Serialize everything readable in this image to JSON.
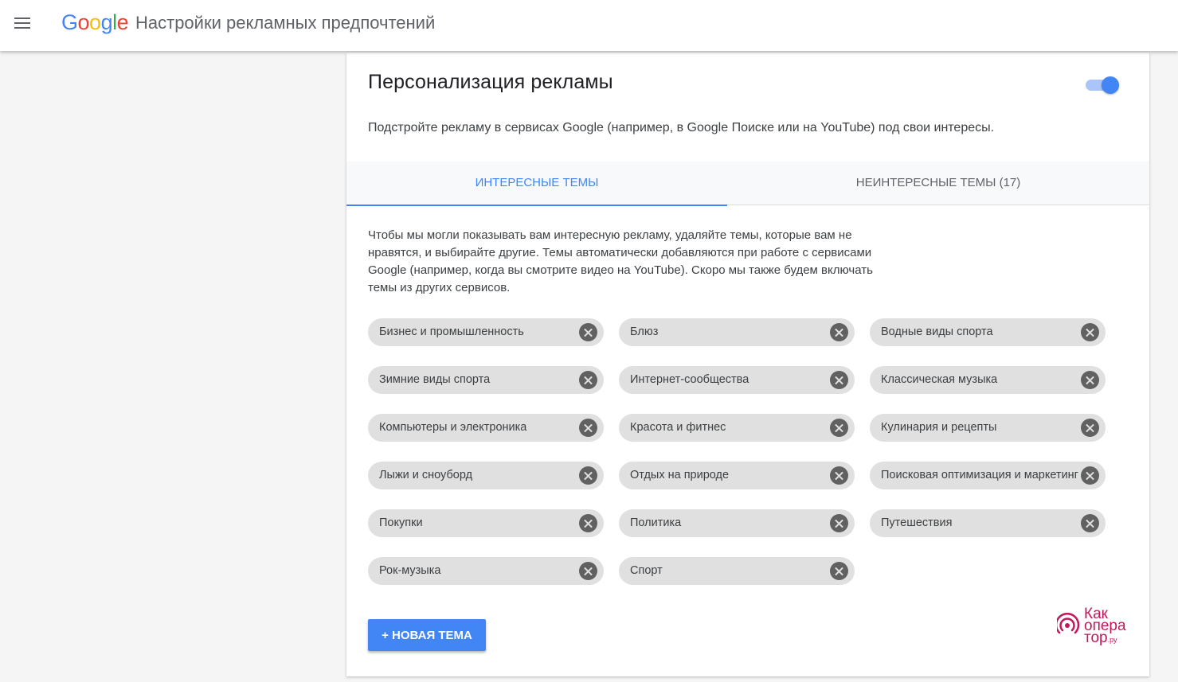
{
  "header": {
    "logo_letters": [
      "G",
      "o",
      "o",
      "g",
      "l",
      "e"
    ],
    "title": "Настройки рекламных предпочтений"
  },
  "personalization": {
    "title": "Персонализация рекламы",
    "enabled": true,
    "description": "Подстройте рекламу в сервисах Google (например, в Google Поиске или на YouTube) под свои интересы."
  },
  "tabs": [
    {
      "label": "ИНТЕРЕСНЫЕ ТЕМЫ",
      "active": true
    },
    {
      "label": "НЕИНТЕРЕСНЫЕ ТЕМЫ (17)",
      "active": false
    }
  ],
  "intro": "Чтобы мы могли показывать вам интересную рекламу, удаляйте темы, которые вам не нравятся, и выбирайте другие. Темы автоматически добавляются при работе с сервисами Google (например, когда вы смотрите видео на YouTube). Скоро мы также будем включать темы из других сервисов.",
  "topics": [
    "Бизнес и промышленность",
    "Блюз",
    "Водные виды спорта",
    "Зимние виды спорта",
    "Интернет-сообщества",
    "Классическая музыка",
    "Компьютеры и электроника",
    "Красота и фитнес",
    "Кулинария и рецепты",
    "Лыжи и сноуборд",
    "Отдых на природе",
    "Поисковая оптимизация и маркетинг",
    "Покупки",
    "Политика",
    "Путешествия",
    "Рок-музыка",
    "Спорт"
  ],
  "new_topic_label": "+ НОВАЯ ТЕМА",
  "watermark": {
    "line1": "Как",
    "line2": "опера",
    "line3": "тор",
    "suffix": ".ру"
  },
  "colors": {
    "accent": "#4285f4",
    "chip_bg": "#e0e0e0",
    "remove_icon": "#616161",
    "watermark": "#c2185b"
  },
  "icons": {
    "menu": "hamburger-icon",
    "remove": "close-circle-icon",
    "watermark": "signal-icon"
  }
}
